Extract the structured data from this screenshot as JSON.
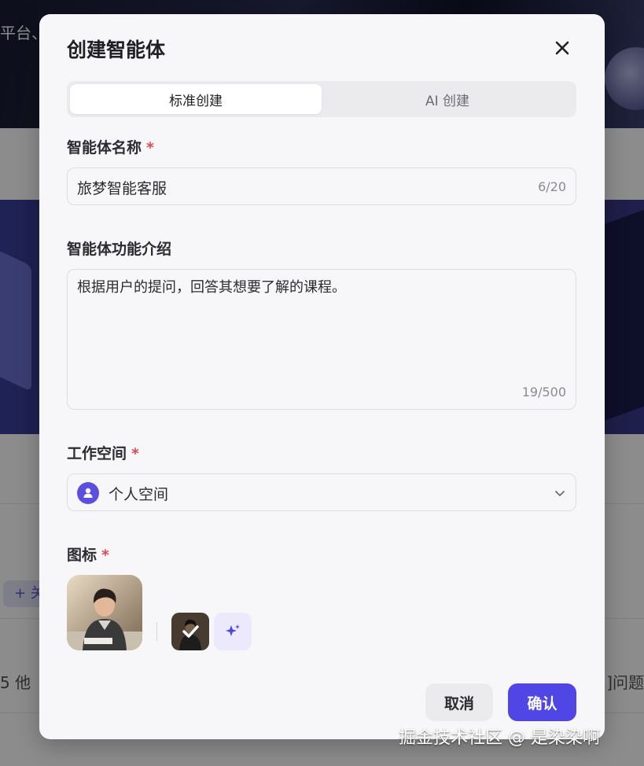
{
  "background": {
    "hero_text": "平台、",
    "tag_text": "+ 关",
    "row_left": "5  他",
    "row_right": "]问题"
  },
  "dialog": {
    "title": "创建智能体",
    "tabs": [
      {
        "label": "标准创建",
        "active": true
      },
      {
        "label": "AI 创建",
        "active": false
      }
    ],
    "name_field": {
      "label": "智能体名称",
      "required_mark": "*",
      "value": "旅梦智能客服",
      "counter": "6/20"
    },
    "description_field": {
      "label": "智能体功能介绍",
      "value": "根据用户的提问，回答其想要了解的课程。",
      "counter": "19/500"
    },
    "workspace_field": {
      "label": "工作空间",
      "required_mark": "*",
      "value": "个人空间"
    },
    "icon_field": {
      "label": "图标",
      "required_mark": "*"
    },
    "buttons": {
      "cancel": "取消",
      "confirm": "确认"
    }
  },
  "watermark": "掘金技术社区 @ 是染染啊",
  "colors": {
    "primary": "#4f46e5",
    "required": "#e5484d",
    "dialog_bg": "#f7f7f9"
  }
}
